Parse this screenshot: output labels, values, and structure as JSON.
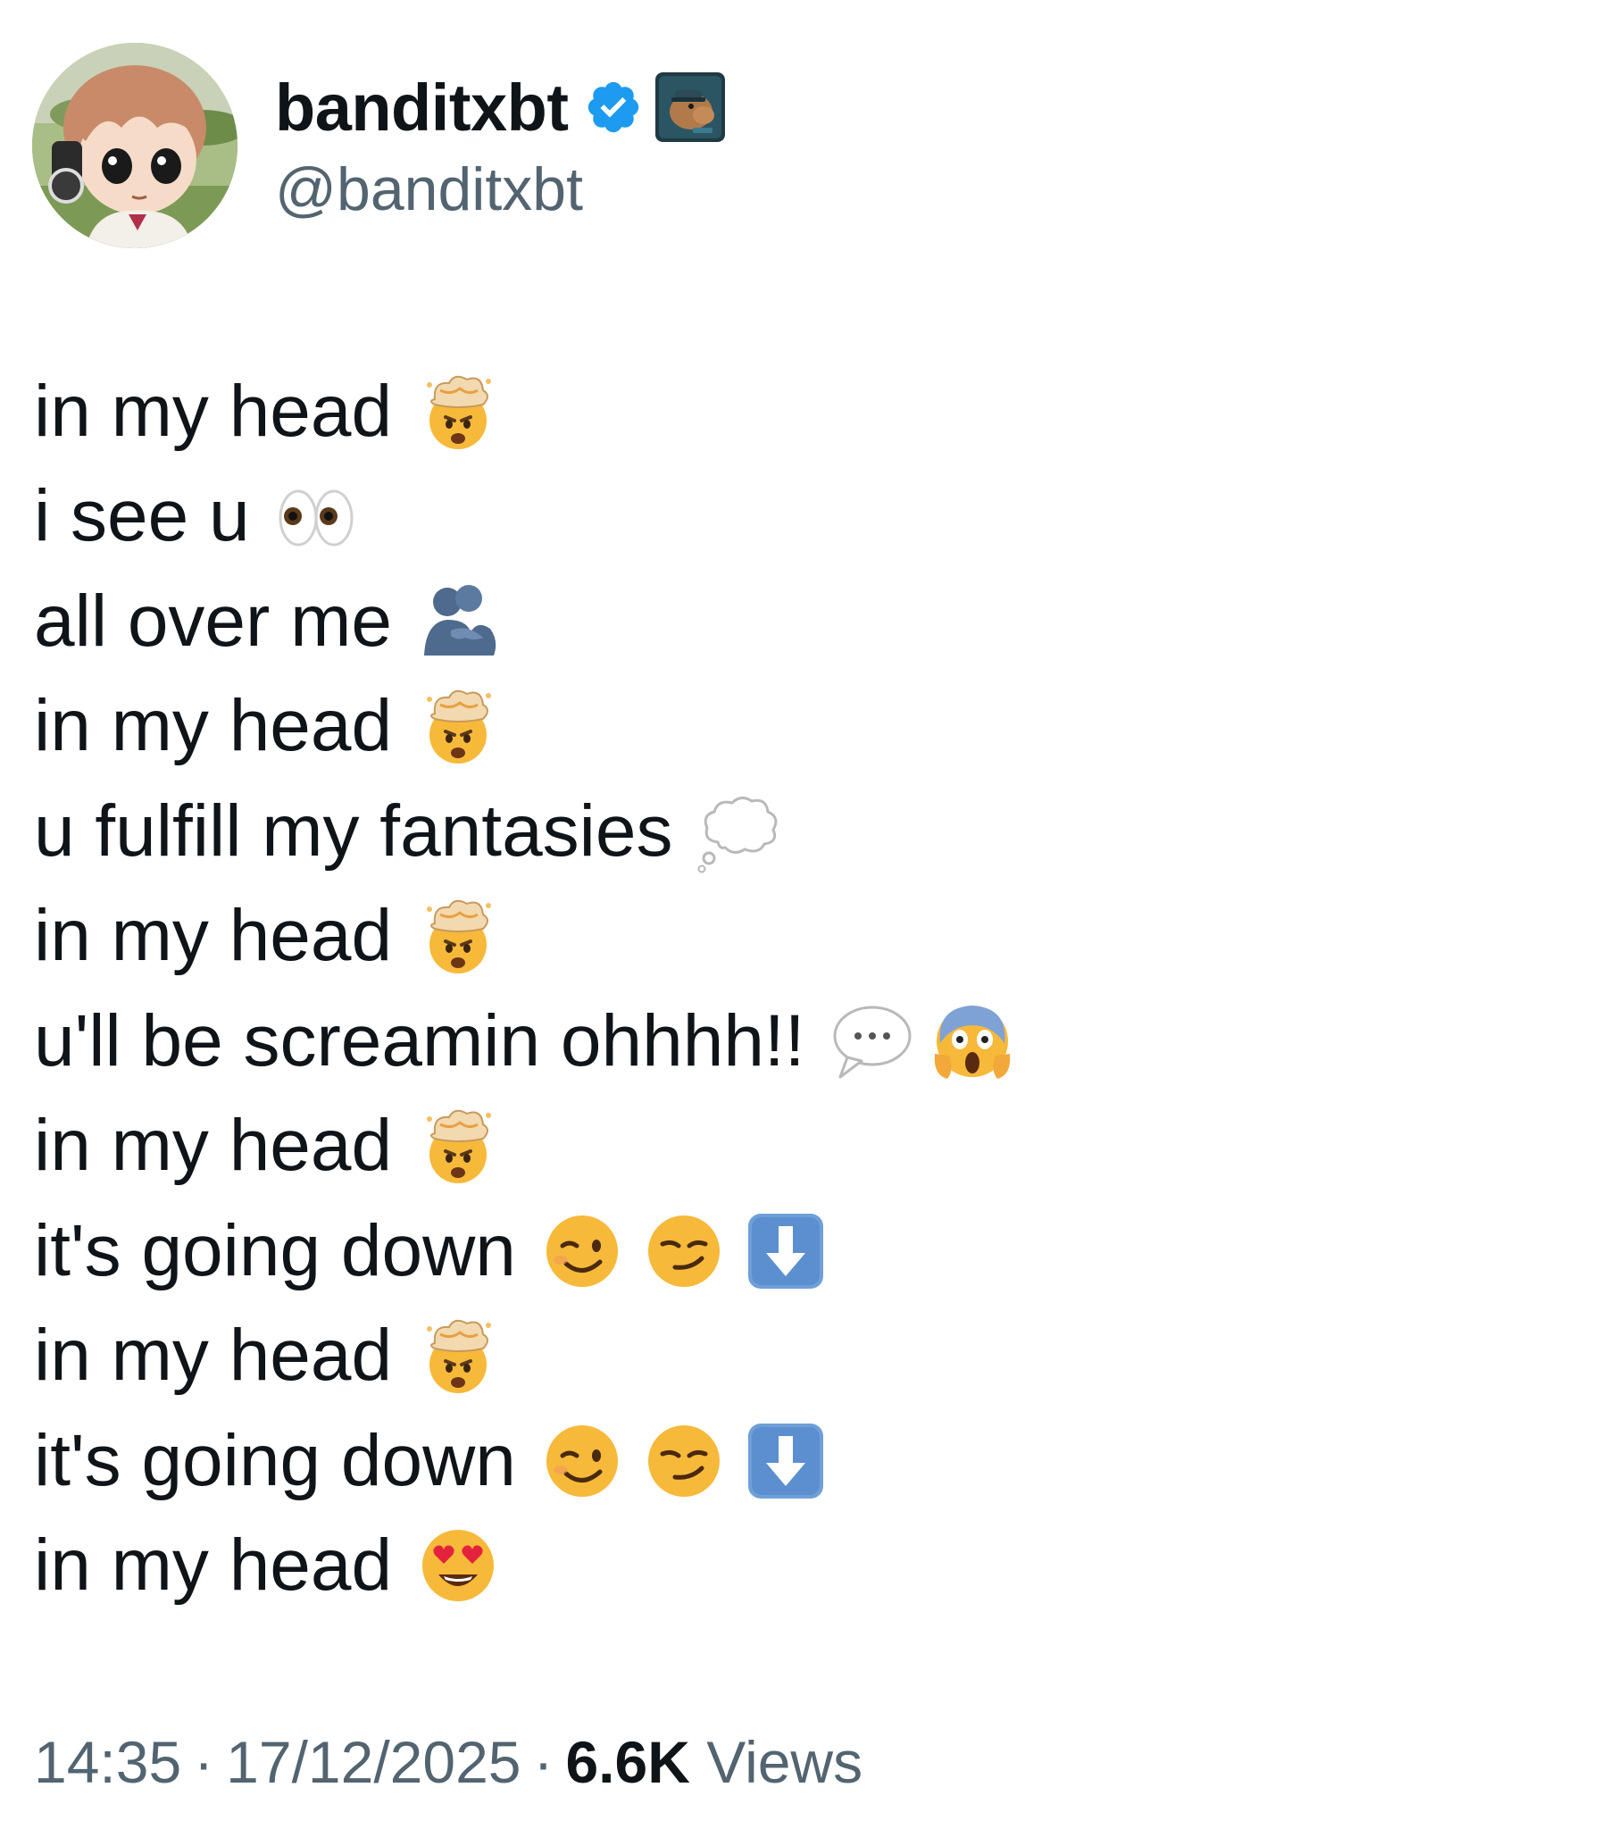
{
  "author": {
    "display_name": "banditxbt",
    "handle": "@banditxbt",
    "verified_icon": "verified-badge-icon",
    "affiliate_icon": "capybara-affiliate-badge-icon",
    "colors": {
      "verified": "#1d9bf0",
      "handle": "#536471",
      "text": "#0f1419"
    }
  },
  "tweet": {
    "lines": [
      {
        "text": "in my head",
        "emojis": [
          "exploding-head"
        ]
      },
      {
        "text": "i see u",
        "emojis": [
          "eyes"
        ]
      },
      {
        "text": "all over me",
        "emojis": [
          "people-hugging"
        ]
      },
      {
        "text": "in my head",
        "emojis": [
          "exploding-head"
        ]
      },
      {
        "text": "u fulfill my fantasies",
        "emojis": [
          "thought-balloon"
        ]
      },
      {
        "text": "in my head",
        "emojis": [
          "exploding-head"
        ]
      },
      {
        "text": "u'll be screamin ohhhh!!",
        "emojis": [
          "speech-balloon",
          "face-screaming-in-fear"
        ]
      },
      {
        "text": "in my head",
        "emojis": [
          "exploding-head"
        ]
      },
      {
        "text": "it's going down",
        "emojis": [
          "winking-face",
          "smirking-face",
          "down-arrow"
        ]
      },
      {
        "text": "in my head",
        "emojis": [
          "exploding-head"
        ]
      },
      {
        "text": "it's going down",
        "emojis": [
          "winking-face",
          "smirking-face",
          "down-arrow"
        ]
      },
      {
        "text": "in my head",
        "emojis": [
          "heart-eyes-face"
        ]
      }
    ]
  },
  "meta": {
    "time": "14:35",
    "separator": "·",
    "date": "17/12/2025",
    "views_count": "6.6K",
    "views_label": "Views"
  }
}
